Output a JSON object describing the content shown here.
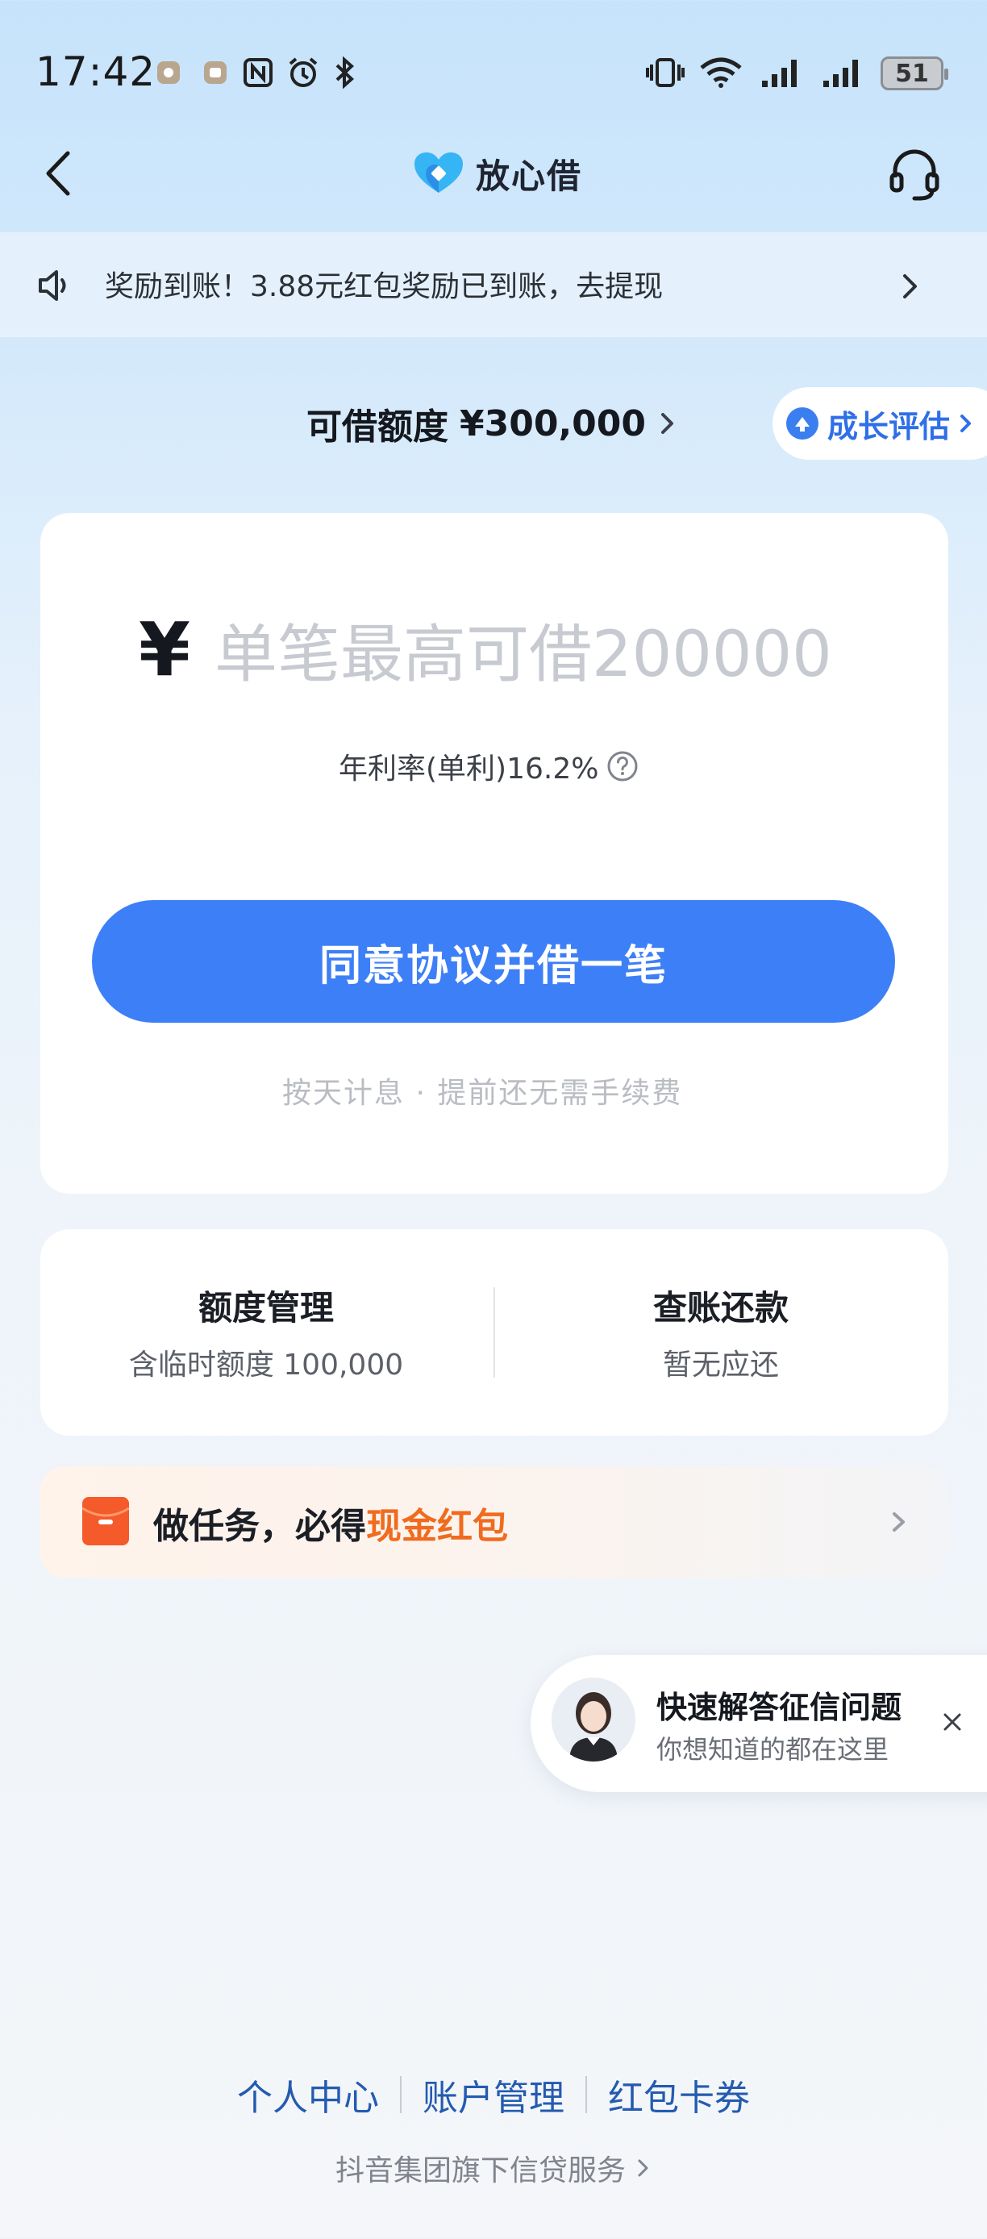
{
  "status_bar": {
    "time": "17:42",
    "battery": "51",
    "icons": [
      "notification-icon",
      "notification-icon",
      "nfc-icon",
      "alarm-icon",
      "bluetooth-icon",
      "vibrate-icon",
      "wifi-icon",
      "signal-icon",
      "signal-icon"
    ]
  },
  "nav": {
    "back_icon": "chevron-left-icon",
    "title": "放心借",
    "support_icon": "headset-icon"
  },
  "notice": {
    "icon": "speaker-icon",
    "text": "奖励到账！3.88元红包奖励已到账，去提现"
  },
  "credit": {
    "label": "可借额度",
    "value": "¥300,000",
    "growth_label": "成长评估"
  },
  "loan": {
    "currency": "¥",
    "amount_placeholder": "单笔最高可借200000",
    "rate_text": "年利率(单利)16.2%",
    "cta": "同意协议并借一笔",
    "cta_sub": "按天计息 · 提前还无需手续费"
  },
  "manage": {
    "left_title": "额度管理",
    "left_sub": "含临时额度 100,000",
    "right_title": "查账还款",
    "right_sub": "暂无应还"
  },
  "task": {
    "prefix": "做任务，必得",
    "highlight": "现金红包"
  },
  "tip": {
    "title": "快速解答征信问题",
    "subtitle": "你想知道的都在这里"
  },
  "footer": {
    "links": [
      "个人中心",
      "账户管理",
      "红包卡券"
    ],
    "note": "抖音集团旗下信贷服务"
  },
  "colors": {
    "primary": "#3d7ff6",
    "accent_orange": "#f06b1e",
    "link_blue": "#245bb0"
  }
}
